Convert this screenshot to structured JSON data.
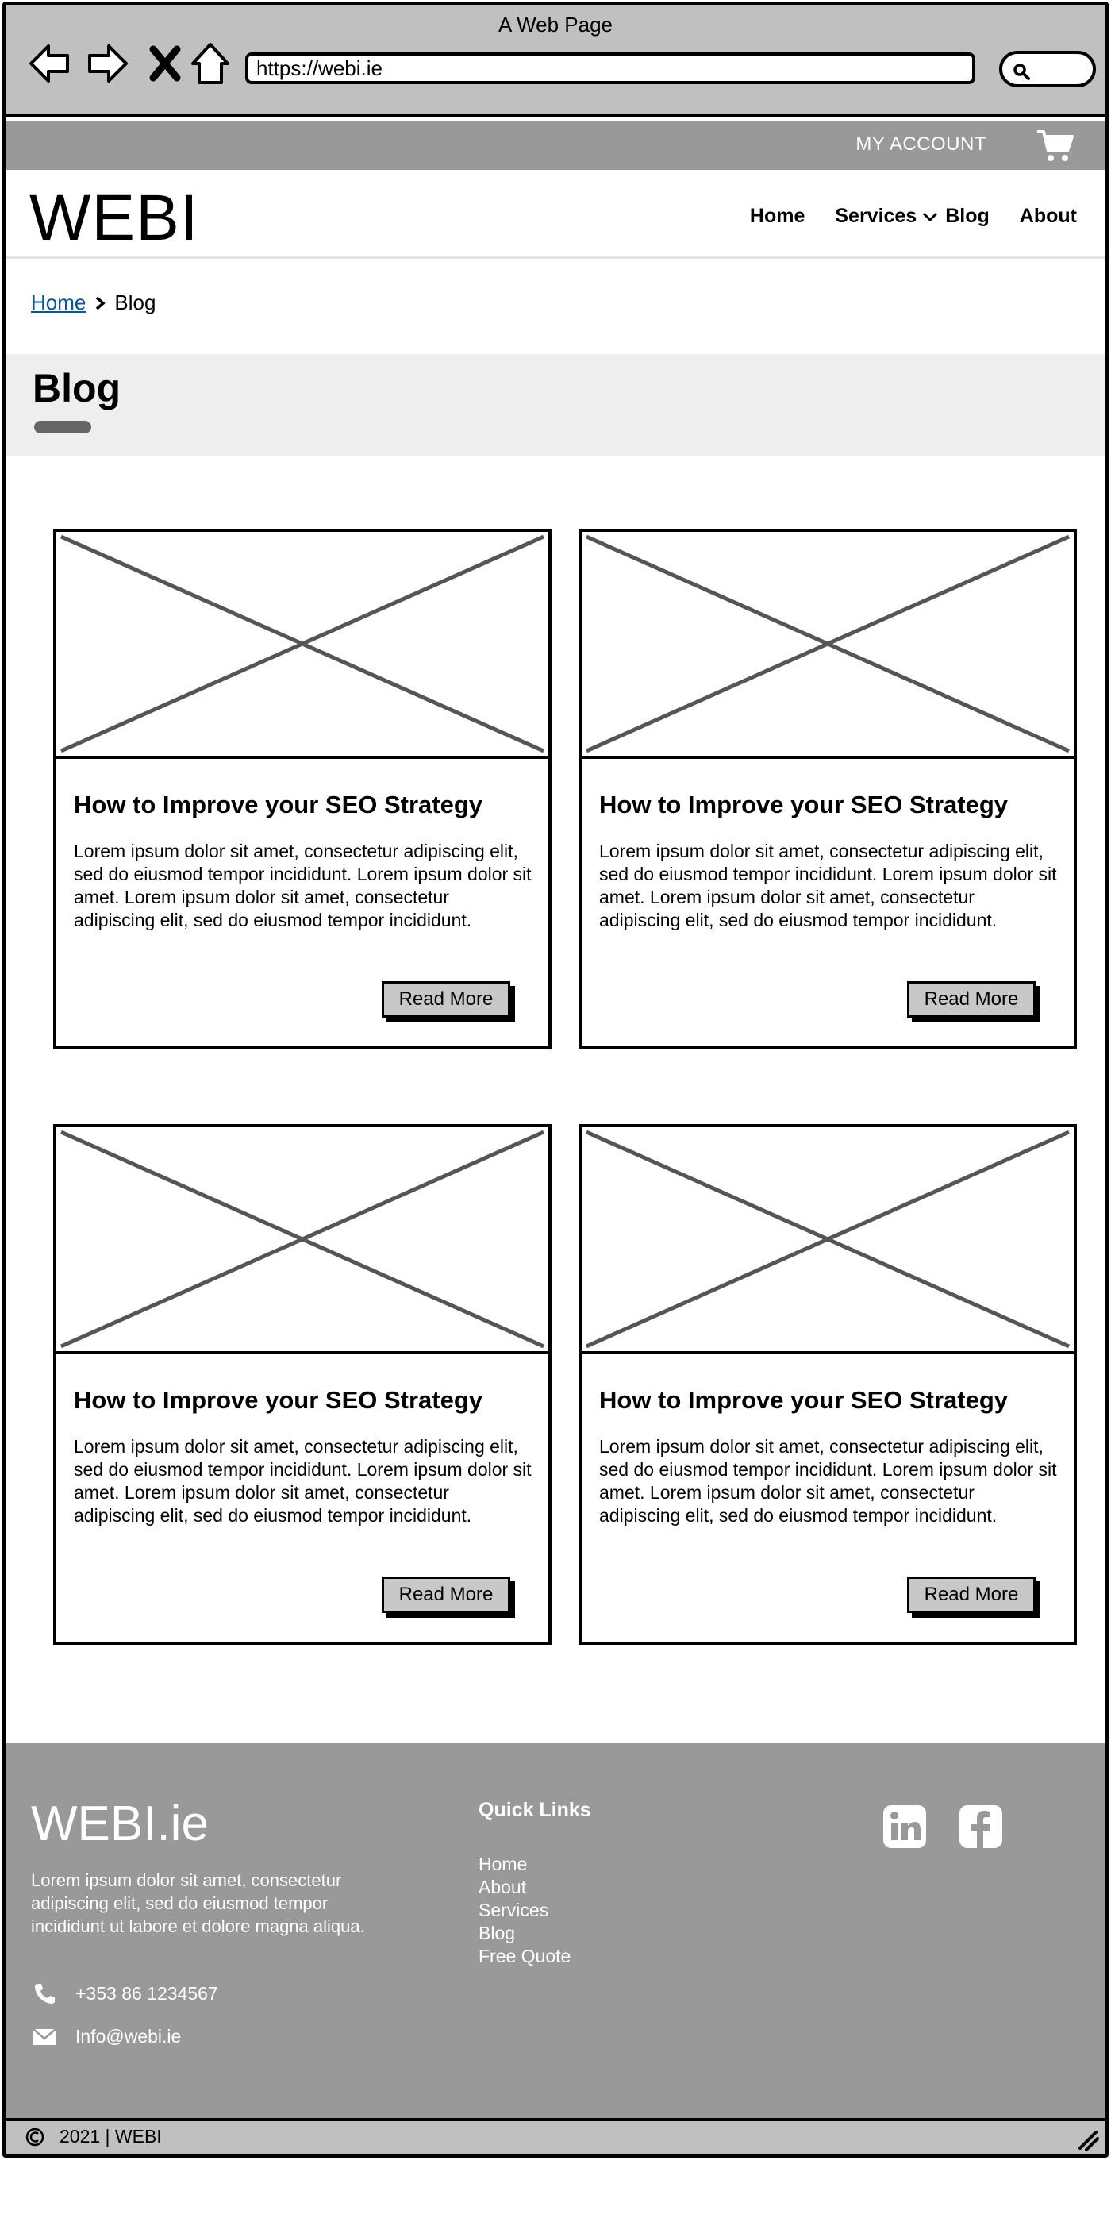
{
  "window": {
    "title": "A Web Page",
    "url": "https://webi.ie"
  },
  "topbar": {
    "account_label": "MY ACCOUNT"
  },
  "header": {
    "logo": "WEBI",
    "nav": {
      "home": "Home",
      "services": "Services",
      "blog": "Blog",
      "about": "About"
    }
  },
  "breadcrumb": {
    "home": "Home",
    "current": "Blog"
  },
  "page": {
    "title": "Blog"
  },
  "cards": [
    {
      "title": "How to Improve your SEO Strategy",
      "text": "Lorem ipsum dolor sit amet, consectetur adipiscing elit, sed do eiusmod tempor incididunt. Lorem ipsum dolor sit amet. Lorem ipsum dolor sit amet, consectetur adipiscing elit, sed do eiusmod tempor incididunt.",
      "button": "Read More"
    },
    {
      "title": "How to Improve your SEO Strategy",
      "text": "Lorem ipsum dolor sit amet, consectetur adipiscing elit, sed do eiusmod tempor incididunt. Lorem ipsum dolor sit amet. Lorem ipsum dolor sit amet, consectetur adipiscing elit, sed do eiusmod tempor incididunt.",
      "button": "Read More"
    },
    {
      "title": "How to Improve your SEO Strategy",
      "text": "Lorem ipsum dolor sit amet, consectetur adipiscing elit, sed do eiusmod tempor incididunt. Lorem ipsum dolor sit amet. Lorem ipsum dolor sit amet, consectetur adipiscing elit, sed do eiusmod tempor incididunt.",
      "button": "Read More"
    },
    {
      "title": "How to Improve your SEO Strategy",
      "text": "Lorem ipsum dolor sit amet, consectetur adipiscing elit, sed do eiusmod tempor incididunt. Lorem ipsum dolor sit amet. Lorem ipsum dolor sit amet, consectetur adipiscing elit, sed do eiusmod tempor incididunt.",
      "button": "Read More"
    }
  ],
  "footer": {
    "logo": "WEBI.ie",
    "description": "Lorem ipsum dolor sit amet, consectetur adipiscing elit, sed do eiusmod tempor incididunt ut labore et dolore magna aliqua.",
    "phone": "+353 86 1234567",
    "email": "Info@webi.ie",
    "quick_links_title": "Quick Links",
    "quick_links": [
      "Home",
      "About",
      "Services",
      "Blog",
      "Free Quote"
    ],
    "social": [
      "linkedin-icon",
      "facebook-icon"
    ]
  },
  "statusbar": {
    "copyright": "2021 | WEBI"
  },
  "colors": {
    "chrome": "#c0c0c0",
    "bar": "#999999",
    "band": "#eeeeee",
    "link": "#0057a0"
  }
}
